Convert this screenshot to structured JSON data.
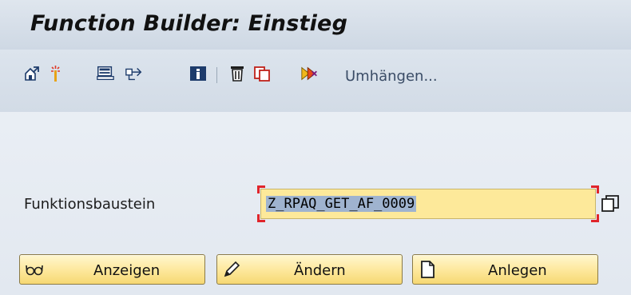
{
  "window": {
    "title": "Function Builder: Einstieg"
  },
  "toolbar": {
    "icons": [
      "other-object-icon",
      "activate-icon",
      "test-icon",
      "where-used-icon",
      "info-icon",
      "delete-icon",
      "copy-icon",
      "rename-icon"
    ],
    "reassign_label": "Umhängen..."
  },
  "form": {
    "field_label": "Funktionsbaustein",
    "field_value": "Z_RPAQ_GET_AF_0009"
  },
  "buttons": {
    "display": "Anzeigen",
    "change": "Ändern",
    "create": "Anlegen"
  },
  "colors": {
    "field_bg": "#fde99a",
    "selection": "#9fb3cf",
    "required_marker": "#e0252b",
    "button_bg": "#fde79a"
  }
}
